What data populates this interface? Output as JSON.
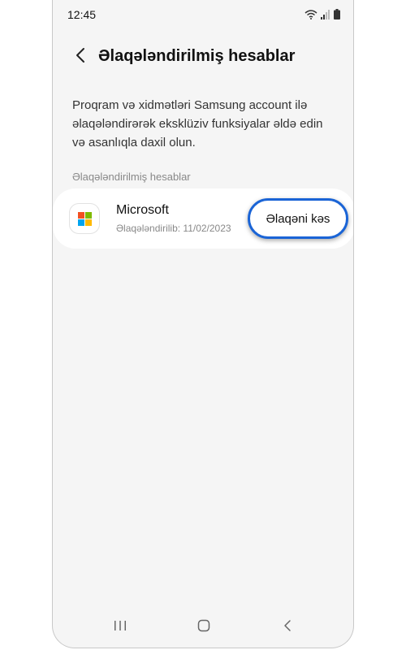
{
  "status_bar": {
    "time": "12:45"
  },
  "header": {
    "title": "Əlaqələndirilmiş hesablar"
  },
  "description": "Proqram və xidmətləri Samsung account ilə əlaqələndirərək eksklüziv funksiyalar əldə edin və asanlıqla daxil olun.",
  "section": {
    "header": "Əlaqələndirilmiş hesablar",
    "accounts": [
      {
        "name": "Microsoft",
        "status": "Əlaqələndirilib: 11/02/2023",
        "action_label": "Əlaqəni kəs",
        "icon": "microsoft-logo-icon"
      }
    ]
  },
  "colors": {
    "accent": "#1a64d6",
    "background": "#f5f5f5",
    "card": "#ffffff",
    "ms_red": "#f25022",
    "ms_green": "#7fba00",
    "ms_blue": "#00a4ef",
    "ms_yellow": "#ffb900"
  },
  "nav_bar": {
    "icons": [
      "recent-apps-icon",
      "home-icon",
      "back-nav-icon"
    ]
  }
}
